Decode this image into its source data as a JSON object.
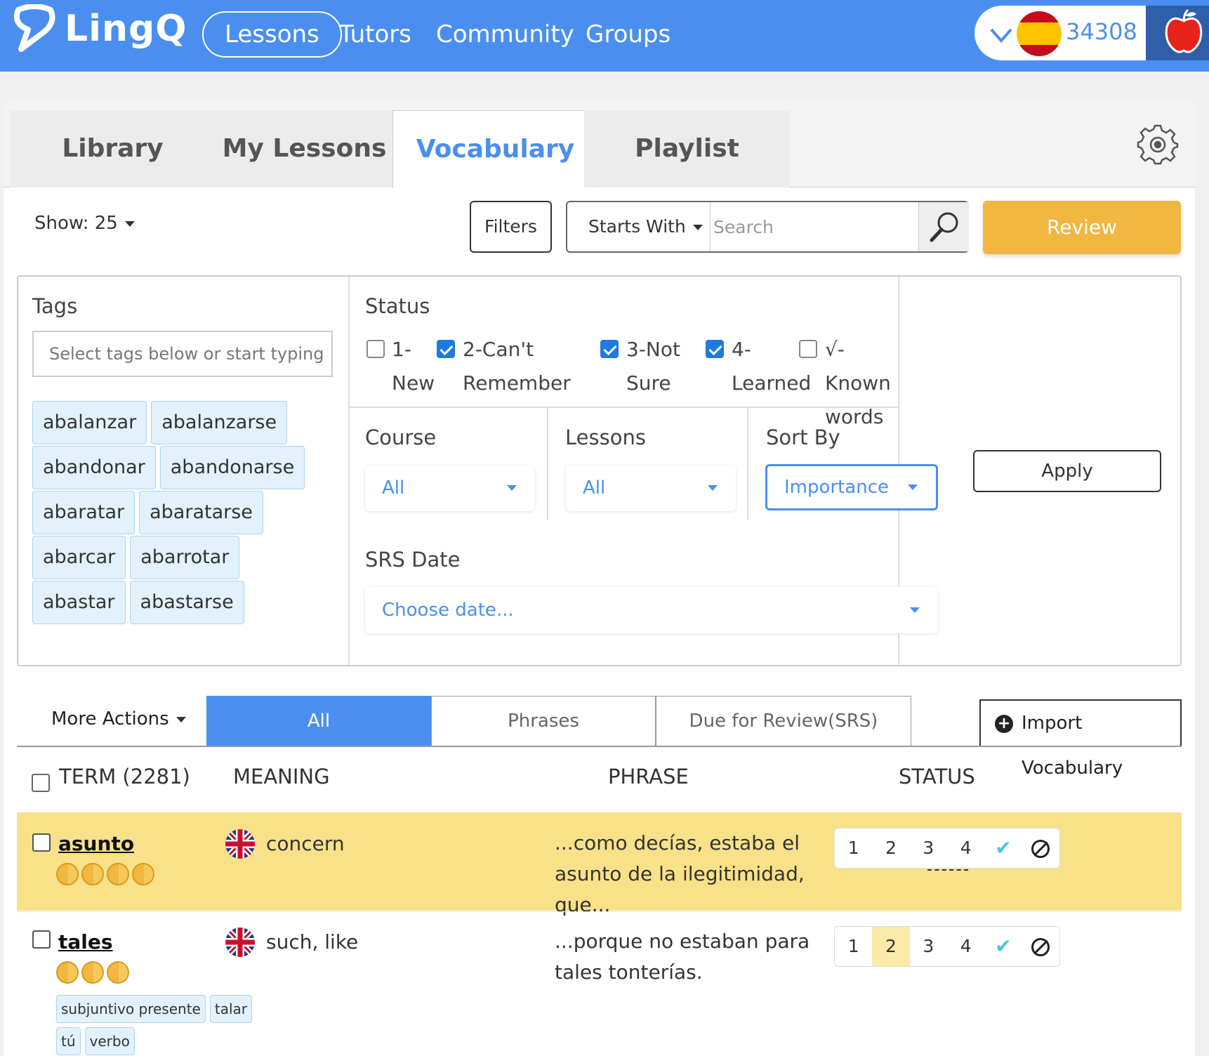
{
  "nav": {
    "logo": "LingQ",
    "links": [
      {
        "label": "Lessons",
        "active": true
      },
      {
        "label": "Tutors"
      },
      {
        "label": "Community"
      },
      {
        "label": "Groups"
      }
    ],
    "coins": "34308",
    "flag_icon": "spain-flag-icon",
    "apple_icon": "apple-icon"
  },
  "tabs": [
    "Library",
    "My Lessons",
    "Vocabulary",
    "Playlist"
  ],
  "active_tab": "Vocabulary",
  "toolbar": {
    "show_label": "Show: 25",
    "filters_label": "Filters",
    "starts_with_label": "Starts With",
    "search_placeholder": "Search",
    "review_label": "Review"
  },
  "filters": {
    "tags_title": "Tags",
    "tags_placeholder": "Select tags below or start typing",
    "tags": [
      "abalanzar",
      "abalanzarse",
      "abandonar",
      "abandonarse",
      "abaratar",
      "abaratarse",
      "abarcar",
      "abarrotar",
      "abastar",
      "abastarse"
    ],
    "status_title": "Status",
    "status_options": [
      {
        "line1": "1-",
        "line2": "New",
        "checked": false
      },
      {
        "line1": "2-Can't",
        "line2": "Remember",
        "checked": true
      },
      {
        "line1": "3-Not",
        "line2": "Sure",
        "checked": true
      },
      {
        "line1": "4-",
        "line2": "Learned",
        "checked": true
      },
      {
        "line1": "√-Known",
        "line2": "words",
        "checked": false
      }
    ],
    "course_title": "Course",
    "course_value": "All",
    "lessons_title": "Lessons",
    "lessons_value": "All",
    "sortby_title": "Sort By",
    "sortby_value": "Importance",
    "srs_title": "SRS Date",
    "srs_placeholder": "Choose date...",
    "apply_label": "Apply"
  },
  "list_toolbar": {
    "more_actions": "More Actions",
    "segments": [
      "All",
      "Phrases",
      "Due for Review(SRS)"
    ],
    "active_segment": "All",
    "import_label": "Import Vocabulary"
  },
  "table": {
    "headers": {
      "term": "TERM (2281)",
      "meaning": "MEANING",
      "phrase": "PHRASE",
      "status": "STATUS"
    },
    "status_buttons": [
      "1",
      "2",
      "3",
      "4"
    ],
    "rows": [
      {
        "term": "asunto",
        "importance": 4,
        "meaning": "concern",
        "phrase": "...como decías, estaba el asunto de la ilegitimidad, que...",
        "status": "4",
        "highlight": true,
        "tags": []
      },
      {
        "term": "tales",
        "importance": 3,
        "meaning": "such, like",
        "phrase": "...porque no estaban para tales tonterías.",
        "status": "2",
        "highlight": false,
        "tags": [
          "subjuntivo presente",
          "talar",
          "tú",
          "verbo"
        ]
      }
    ]
  },
  "colors": {
    "nav_blue": "#4a8ff0",
    "review_orange": "#f2b740",
    "highlight_row": "#f8e188",
    "chip_bg": "#e2f1fb"
  }
}
